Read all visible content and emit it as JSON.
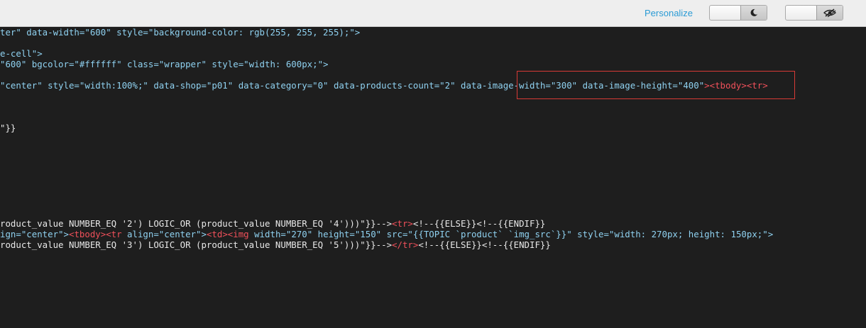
{
  "toolbar": {
    "personalize_label": "Personalize",
    "dark_mode_icon": "moon-icon",
    "hide_icon": "eye-slash-icon"
  },
  "code_lines": {
    "l1": {
      "a": "ter\" data-width=\"600\" style=\"background-color: rgb(255, 255, 255);\">"
    },
    "l2": {
      "a": "e-cell\">"
    },
    "l3": {
      "a": "\"600\" bgcolor=\"#ffffff\" class=\"wrapper\" style=\"width: 600px;\">"
    },
    "l4": {
      "a": "\"center\" style=\"width:100%;\" data-shop=\"p01\" data-category=\"0\" data-products-count=\"2\" ",
      "b": "data-image-width=\"300\" data-image-height=\"400\"",
      "c": "><tbody><tr>"
    },
    "l5": {
      "a": "\"}}"
    },
    "l6": {
      "a": "roduct_value NUMBER_EQ '2') LOGIC_OR (product_value NUMBER_EQ '4')))\"}}-->",
      "b": "<tr>",
      "c": "<!--{{ELSE}}<!--{{ENDIF}}"
    },
    "l7": {
      "a": "ign=\"center\">",
      "b": "<tbody><tr",
      "c": " align=\"center\">",
      "d": "<td><img",
      "e": " width=\"270\" height=\"150\" src=\"{{TOPIC `product` `img_src`}}\" style=\"width: 270px; height: 150px;\">"
    },
    "l8": {
      "a": "roduct_value NUMBER_EQ '3') LOGIC_OR (product_value NUMBER_EQ '5')))\"}}-->",
      "b": "</tr>",
      "c": "<!--{{ELSE}}<!--{{ENDIF}}"
    }
  },
  "colors": {
    "editor_bg": "#1e1e1e",
    "attribute": "#8fd1f0",
    "string": "#e6db74",
    "tag": "#f0505a",
    "highlight_border": "#d83a36",
    "personalize_link": "#2a9bd5"
  }
}
